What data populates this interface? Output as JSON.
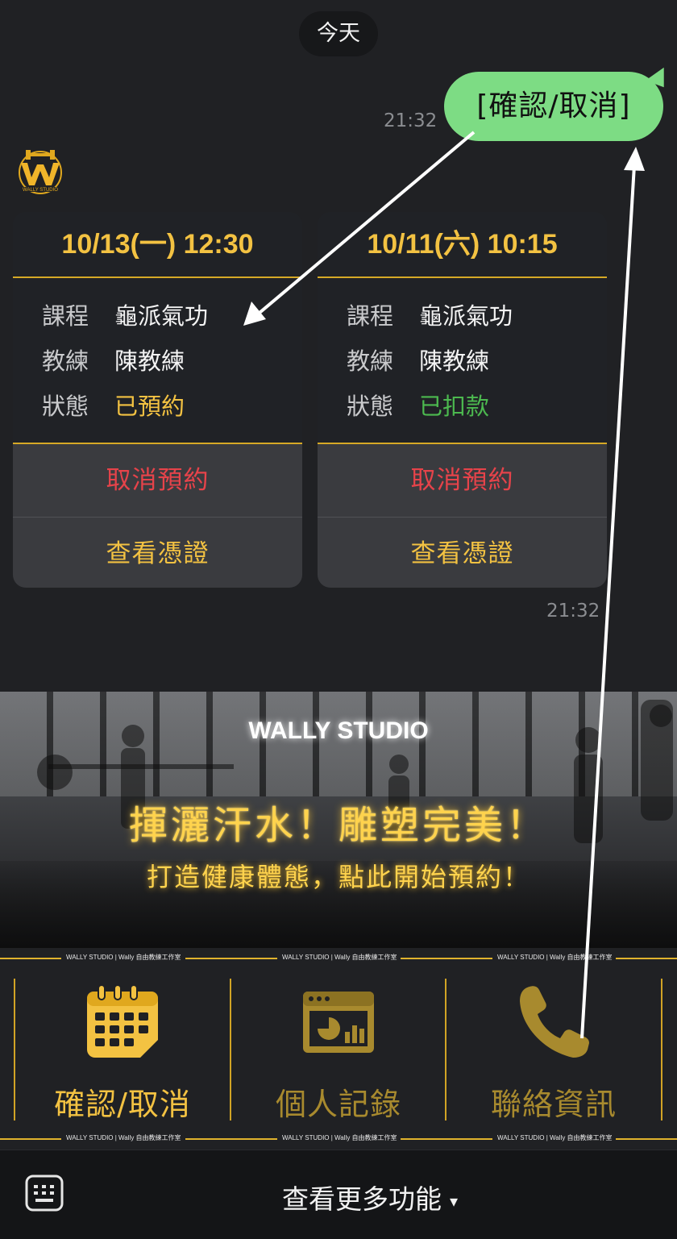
{
  "chat": {
    "date_label": "今天",
    "sent_message": "[確認/取消]",
    "sent_time": "21:32",
    "received_time": "21:32"
  },
  "cards": [
    {
      "datetime": "10/13(一) 12:30",
      "course_label": "課程",
      "course": "龜派氣功",
      "coach_label": "教練",
      "coach": "陳教練",
      "status_label": "狀態",
      "status": "已預約",
      "status_color": "#f3c242",
      "cancel_label": "取消預約",
      "voucher_label": "查看憑證"
    },
    {
      "datetime": "10/11(六) 10:15",
      "course_label": "課程",
      "course": "龜派氣功",
      "coach_label": "教練",
      "coach": "陳教練",
      "status_label": "狀態",
      "status": "已扣款",
      "status_color": "#4cb94f",
      "cancel_label": "取消預約",
      "voucher_label": "查看憑證"
    }
  ],
  "banner": {
    "brand": "WALLY STUDIO",
    "headline": "揮灑汗水！雕塑完美！",
    "subline": "打造健康體態，點此開始預約！"
  },
  "rich_menu": {
    "strip_text": "WALLY STUDIO | Wally 自由教練工作室",
    "items": [
      {
        "label": "確認/取消",
        "icon": "calendar-icon",
        "color": "#f3c242"
      },
      {
        "label": "個人記錄",
        "icon": "chart-window-icon",
        "color": "#a88a2e"
      },
      {
        "label": "聯絡資訊",
        "icon": "phone-icon",
        "color": "#a88a2e"
      }
    ]
  },
  "bottom_bar": {
    "more_label": "查看更多功能",
    "caret": "▾",
    "keyboard_icon": "keyboard-icon"
  },
  "colors": {
    "accent_gold": "#f3c242",
    "bubble_green": "#7ddc84",
    "cancel_red": "#e6434a",
    "background": "#202124"
  }
}
